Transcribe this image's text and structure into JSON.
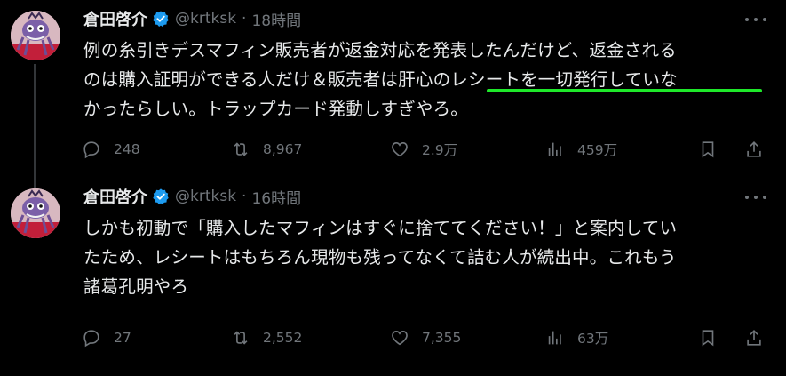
{
  "tweets": [
    {
      "author": {
        "name": "倉田啓介",
        "handle": "@krtksk"
      },
      "time": "18時間",
      "lines": [
        "例の糸引きデスマフィン販売者が返金対応を発表したんだけど、返金される",
        "のは購入証明ができる人だけ＆販売者は肝心のレシートを一切発行していな",
        "かったらしい。トラップカード発動しすぎやろ。"
      ],
      "stats": {
        "replies": "248",
        "retweets": "8,967",
        "likes": "2.9万",
        "views": "459万"
      },
      "highlight_color": "#1ee82a"
    },
    {
      "author": {
        "name": "倉田啓介",
        "handle": "@krtksk"
      },
      "time": "16時間",
      "lines": [
        "しかも初動で「購入したマフィンはすぐに捨ててください！」と案内してい",
        "たため、レシートはもちろん現物も残ってなくて詰む人が続出中。これもう",
        "諸葛孔明やろ"
      ],
      "stats": {
        "replies": "27",
        "retweets": "2,552",
        "likes": "7,355",
        "views": "63万"
      }
    }
  ],
  "colors": {
    "background": "#000000",
    "text": "#e7e9ea",
    "muted": "#71767b",
    "verified": "#1d9bf0",
    "thread_line": "#333639"
  }
}
